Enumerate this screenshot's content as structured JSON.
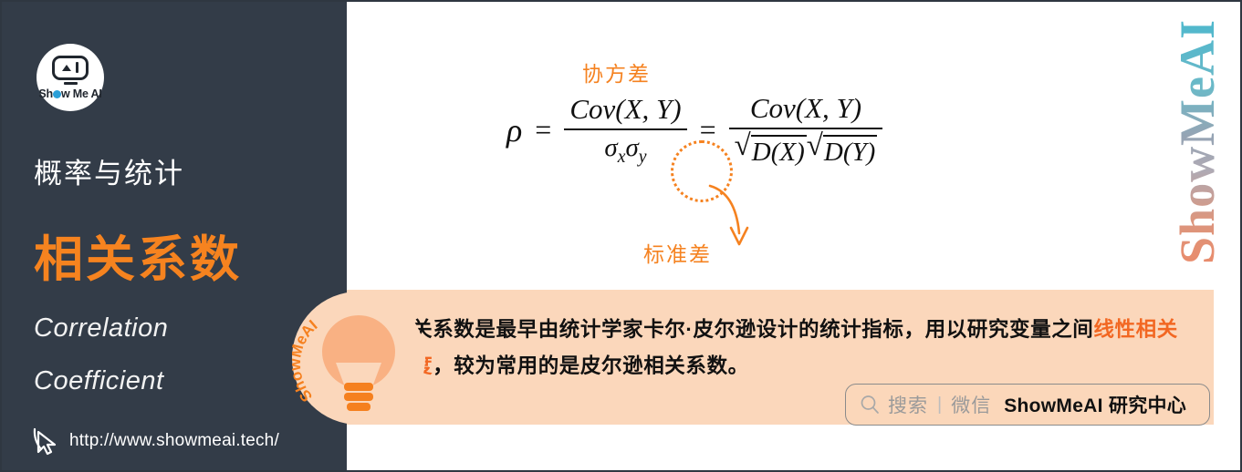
{
  "sidebar": {
    "logo": {
      "brand_text_a": "Sh",
      "brand_text_b": "w Me AI",
      "icon": "robot-head-icon"
    },
    "subject": "概率与统计",
    "topic": "相关系数",
    "english_line_1": "Correlation",
    "english_line_2": "Coefficient",
    "url": "http://www.showmeai.tech/",
    "cursor_icon": "mouse-pointer-icon",
    "bg_color": "#333C48",
    "accent_color": "#F6831F"
  },
  "content": {
    "watermark": "ShowMeAI",
    "annotation_covariance": "协方差",
    "annotation_stddev": "标准差",
    "formula": {
      "lhs": "ρ",
      "equals": "=",
      "frac1_numerator": "Cov(X, Y)",
      "frac1_denominator_sigma_x": "σ",
      "frac1_denominator_sigma_x_sub": "x",
      "frac1_denominator_sigma_y": "σ",
      "frac1_denominator_sigma_y_sub": "y",
      "equals2": "=",
      "frac2_numerator": "Cov(X, Y)",
      "frac2_den_sqrt1_symbol": "√",
      "frac2_den_sqrt1_body": "D(X)",
      "frac2_den_sqrt2_symbol": "√",
      "frac2_den_sqrt2_body": "D(Y)",
      "plain_text": "ρ = Cov(X,Y) / (σx σy) = Cov(X,Y) / (√D(X) √D(Y))"
    }
  },
  "infobox": {
    "bg_color": "#FBD7BB",
    "badge_icon": "light-bulb-icon",
    "badge_curved_text": "ShowMeAI",
    "line1_part1": "相关系数是最早由统计学家卡尔·皮尔逊设计的统计指标，用以研究变量之间",
    "line2_highlight": "线性相关程度",
    "line2_rest": "，较为常用的是皮尔逊相关系数。",
    "highlight_color": "#F26722"
  },
  "search_pill": {
    "icon": "search-icon",
    "placeholder": "搜索",
    "divider": "|",
    "source": "微信",
    "brand": "ShowMeAI 研究中心"
  }
}
